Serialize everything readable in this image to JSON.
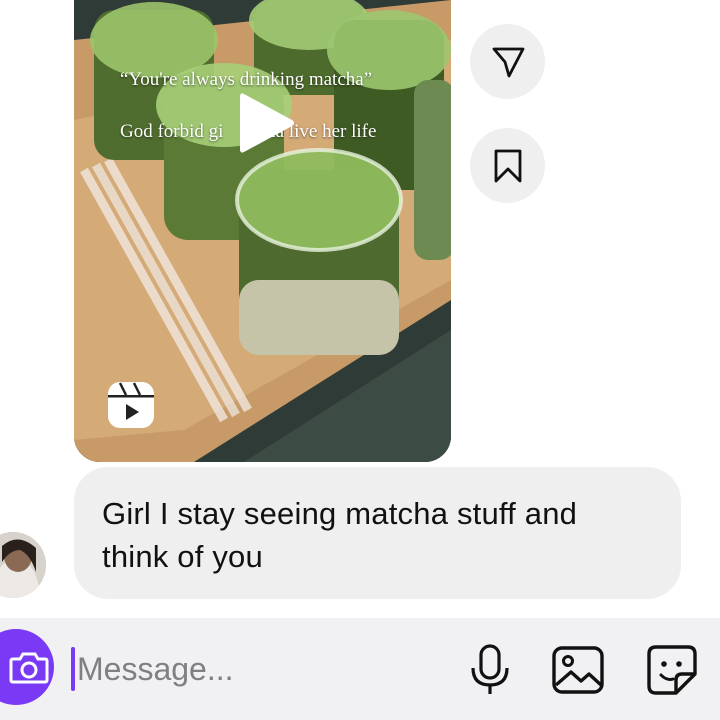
{
  "reel": {
    "caption_line1": "“You're always drinking matcha”",
    "caption_line2": "God forbid gi   na live her life"
  },
  "message": {
    "text_line1": "Girl I stay seeing matcha stuff and",
    "text_line2": "think of you"
  },
  "composer": {
    "placeholder": "Message...",
    "value": ""
  },
  "colors": {
    "accent": "#7a39f5",
    "bubble": "#efefef",
    "composer_bg": "#f1f1f3"
  },
  "icons": [
    "play-icon",
    "reels-icon",
    "send-icon",
    "bookmark-icon",
    "camera-icon",
    "microphone-icon",
    "gallery-icon",
    "sticker-icon"
  ]
}
